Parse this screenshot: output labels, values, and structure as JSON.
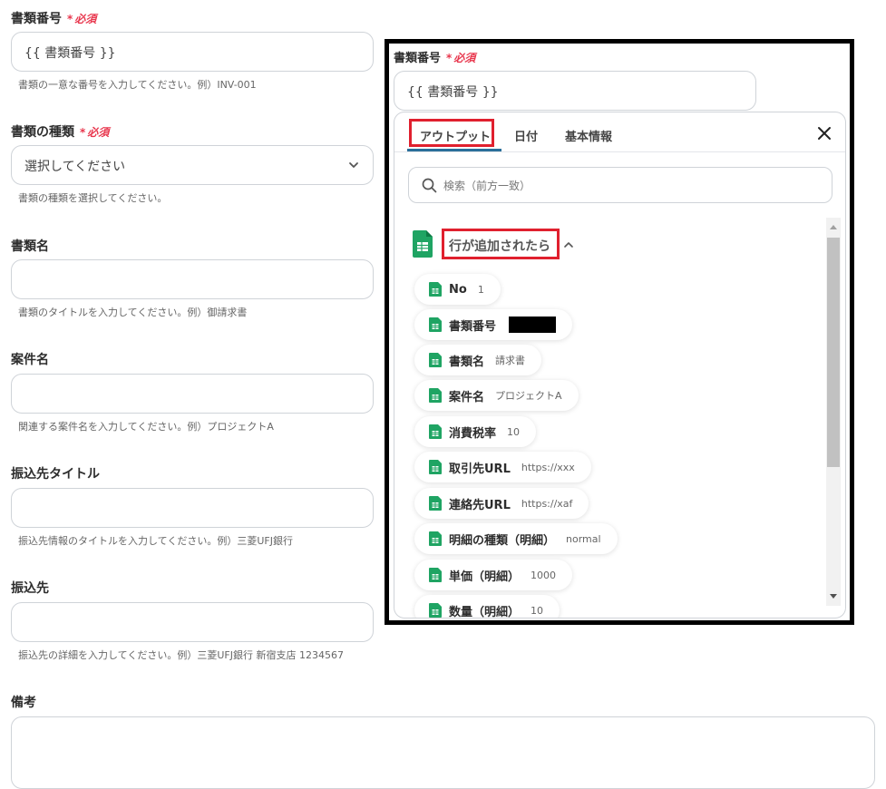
{
  "form": {
    "doc_number": {
      "label": "書類番号",
      "required": "必須",
      "value": "{{ 書類番号 }}",
      "help": "書類の一意な番号を入力してください。例）INV-001"
    },
    "doc_type": {
      "label": "書類の種類",
      "required": "必須",
      "value": "選択してください",
      "help": "書類の種類を選択してください。"
    },
    "doc_name": {
      "label": "書類名",
      "value": "",
      "help": "書類のタイトルを入力してください。例）御請求書"
    },
    "case_name": {
      "label": "案件名",
      "value": "",
      "help": "関連する案件名を入力してください。例）プロジェクトA"
    },
    "transfer_title": {
      "label": "振込先タイトル",
      "value": "",
      "help": "振込先情報のタイトルを入力してください。例）三菱UFJ銀行"
    },
    "transfer_dest": {
      "label": "振込先",
      "value": "",
      "help": "振込先の詳細を入力してください。例）三菱UFJ銀行 新宿支店 1234567"
    },
    "remarks": {
      "label": "備考",
      "value": ""
    }
  },
  "panel": {
    "label": "書類番号",
    "required": "必須",
    "value": "{{ 書類番号 }}",
    "tabs": [
      {
        "label": "アウトプット"
      },
      {
        "label": "日付"
      },
      {
        "label": "基本情報"
      }
    ],
    "search_placeholder": "検索（前方一致）",
    "trigger_label": "行が追加されたら",
    "items": [
      {
        "key": "No",
        "value": "1"
      },
      {
        "key": "書類番号",
        "value": ""
      },
      {
        "key": "書類名",
        "value": "請求書"
      },
      {
        "key": "案件名",
        "value": "プロジェクトA"
      },
      {
        "key": "消費税率",
        "value": "10"
      },
      {
        "key": "取引先URL",
        "value": "https://xxx"
      },
      {
        "key": "連絡先URL",
        "value": "https://xaf"
      },
      {
        "key": "明細の種類（明細）",
        "value": "normal"
      },
      {
        "key": "単価（明細）",
        "value": "1000"
      },
      {
        "key": "数量（明細）",
        "value": "10"
      }
    ],
    "colors": {
      "accent_red": "#e0202e",
      "sheets_green": "#1fa463",
      "tab_underline": "#2a6f9a"
    }
  }
}
